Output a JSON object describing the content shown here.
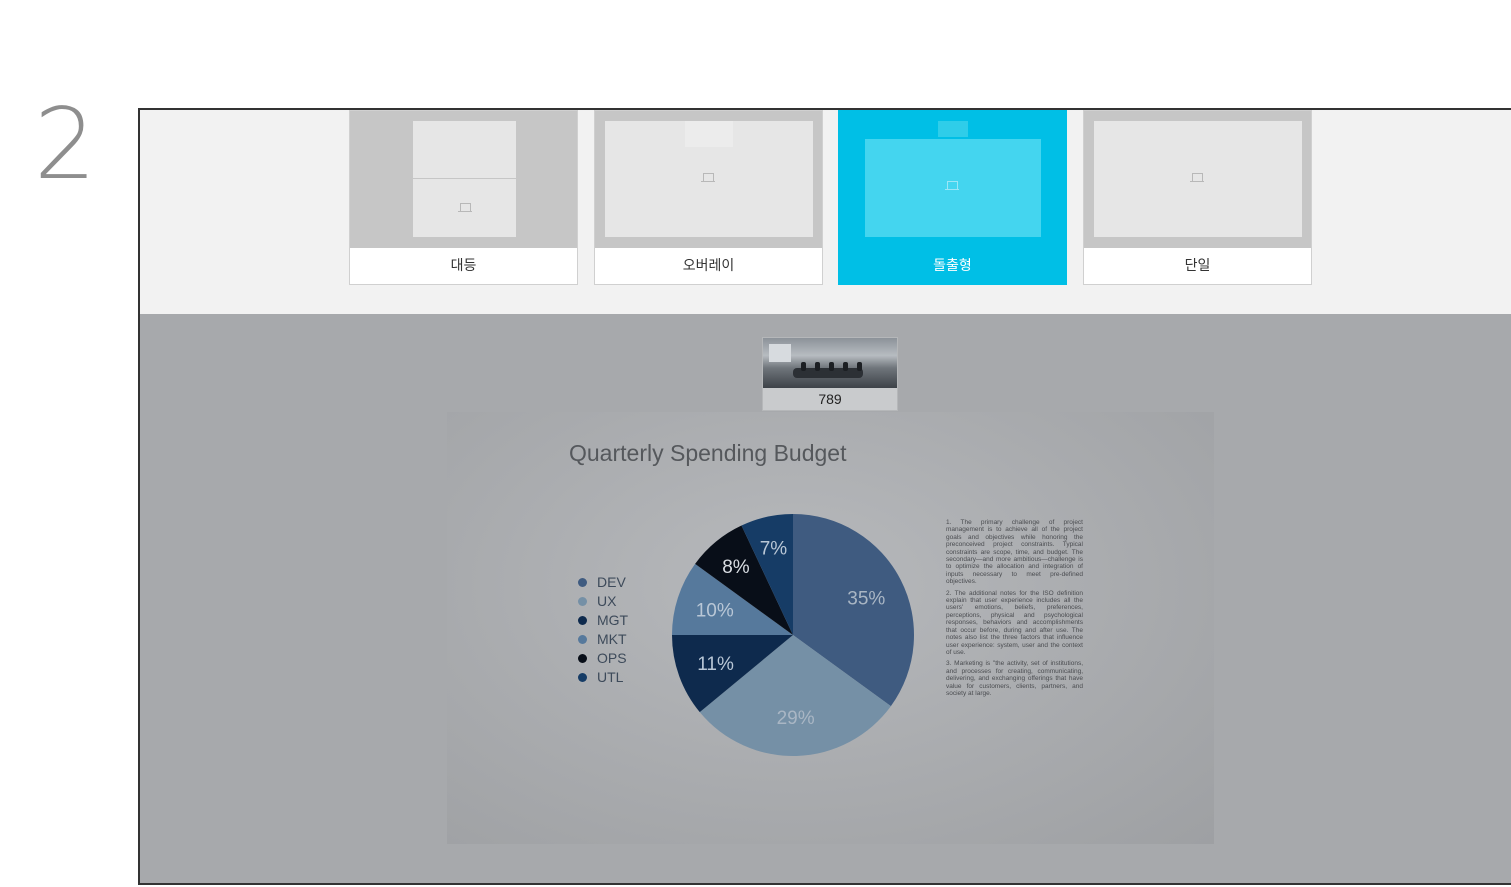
{
  "step_number": "2",
  "layouts": [
    {
      "label": "대등",
      "selected": false,
      "icon": "laptop-icon"
    },
    {
      "label": "오버레이",
      "selected": false,
      "icon": "laptop-icon"
    },
    {
      "label": "돌출형",
      "selected": true,
      "icon": "laptop-icon"
    },
    {
      "label": "단일",
      "selected": false,
      "icon": "laptop-icon"
    }
  ],
  "colors": {
    "selected_accent": "#00bfe6",
    "card_grey": "#c6c6c6",
    "main_background": "#a7a9ac"
  },
  "participant": {
    "label": "789"
  },
  "slide": {
    "title": "Quarterly Spending Budget",
    "notes": [
      "1. The primary challenge of project management is to achieve all of the project goals and objectives while honoring the preconceived project constraints. Typical constraints are scope, time, and budget. The secondary—and more ambitious—challenge is to optimize the allocation and integration of inputs necessary to meet pre-defined objectives.",
      "2. The additional notes for the ISO definition explain that user experience includes all the users' emotions, beliefs, preferences, perceptions, physical and psychological responses, behaviors and accomplishments that occur before, during and after use. The notes also list the three factors that influence user experience: system, user and the context of use.",
      "3. Marketing is \"the activity, set of institutions, and processes for creating, communicating, delivering, and exchanging offerings that have value for customers, clients, partners, and society at large."
    ]
  },
  "chart_data": {
    "type": "pie",
    "title": "Quarterly Spending Budget",
    "legend_position": "left",
    "categories": [
      "DEV",
      "UX",
      "MGT",
      "MKT",
      "OPS",
      "UTL"
    ],
    "values": [
      35,
      29,
      11,
      10,
      8,
      7
    ],
    "labels": [
      "35%",
      "29%",
      "11%",
      "10%",
      "8%",
      "7%"
    ],
    "colors": [
      "#3f5b80",
      "#7590a6",
      "#0e2a4d",
      "#56799c",
      "#080e18",
      "#163c66"
    ]
  }
}
